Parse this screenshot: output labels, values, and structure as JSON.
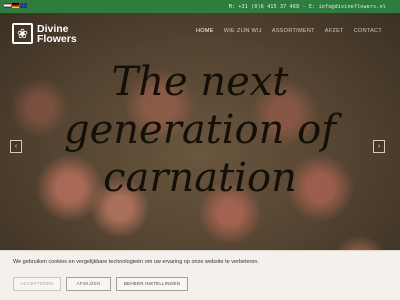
{
  "topbar": {
    "contact": "M: +31 (0)6 415 37 468 - E: info@divineflowers.nl",
    "bg_color": "#2e7d3e",
    "languages": [
      "nl",
      "de",
      "en"
    ]
  },
  "logo": {
    "line1": "Divine",
    "line2": "Flowers",
    "mark_glyph": "❀"
  },
  "nav": {
    "items": [
      "HOME",
      "WIE ZIJN WIJ",
      "ASSORTIMENT",
      "AFZET",
      "CONTACT"
    ],
    "active_index": 0
  },
  "hero": {
    "headline_lines": [
      "The next",
      "generation of",
      "carnation"
    ],
    "prev_glyph": "‹",
    "next_glyph": "›"
  },
  "cookie": {
    "text": "We gebruiken cookies en vergelijkbare technologieën om uw ervaring op onze website te verbeteren.",
    "accept": "ACCEPTEREN",
    "reject": "AFWIJZEN",
    "manage": "BEHEER INSTELLINGEN"
  }
}
